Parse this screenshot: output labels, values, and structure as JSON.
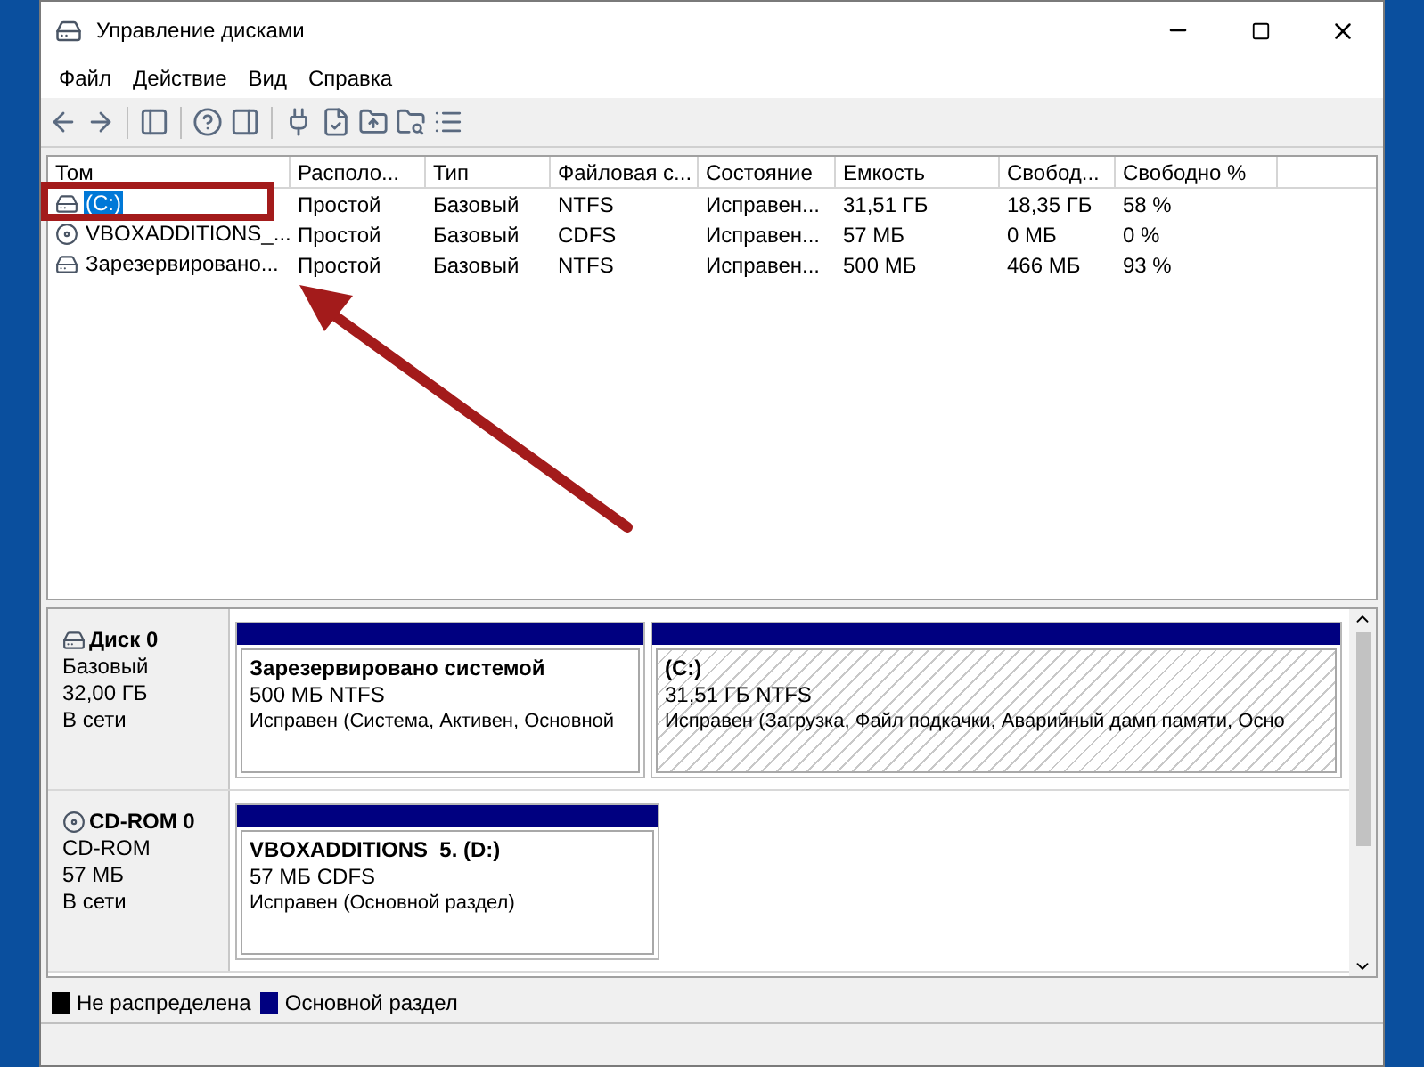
{
  "window": {
    "title": "Управление дисками"
  },
  "menu": [
    "Файл",
    "Действие",
    "Вид",
    "Справка"
  ],
  "volumes": {
    "columns": [
      "Том",
      "Располо...",
      "Тип",
      "Файловая с...",
      "Состояние",
      "Емкость",
      "Свобод...",
      "Свободно %"
    ],
    "rows": [
      {
        "kind": "hdd",
        "selected": true,
        "cells": [
          "(C:)",
          "Простой",
          "Базовый",
          "NTFS",
          "Исправен...",
          "31,51 ГБ",
          "18,35 ГБ",
          "58 %"
        ]
      },
      {
        "kind": "cdrom",
        "selected": false,
        "cells": [
          "VBOXADDITIONS_...",
          "Простой",
          "Базовый",
          "CDFS",
          "Исправен...",
          "57 МБ",
          "0 МБ",
          "0 %"
        ]
      },
      {
        "kind": "hdd",
        "selected": false,
        "cells": [
          "Зарезервировано...",
          "Простой",
          "Базовый",
          "NTFS",
          "Исправен...",
          "500 МБ",
          "466 МБ",
          "93 %"
        ]
      }
    ]
  },
  "disks": [
    {
      "kind": "hdd",
      "name": "Диск 0",
      "type": "Базовый",
      "size": "32,00 ГБ",
      "status": "В сети",
      "partitions": [
        {
          "title": "Зарезервировано системой",
          "size": "500 МБ NTFS",
          "status": "Исправен (Система, Активен, Основной",
          "selected": false
        },
        {
          "title": "(C:)",
          "size": "31,51 ГБ NTFS",
          "status": "Исправен (Загрузка, Файл подкачки, Аварийный дамп памяти, Осно",
          "selected": true
        }
      ]
    },
    {
      "kind": "cdrom",
      "name": "CD-ROM 0",
      "type": "CD-ROM",
      "size": "57 МБ",
      "status": "В сети",
      "partitions": [
        {
          "title": "VBOXADDITIONS_5.  (D:)",
          "size": "57 МБ CDFS",
          "status": "Исправен (Основной раздел)",
          "selected": false
        }
      ]
    }
  ],
  "legend": [
    {
      "label": "Не распределена",
      "color": "#000000"
    },
    {
      "label": "Основной раздел",
      "color": "#000080"
    }
  ]
}
